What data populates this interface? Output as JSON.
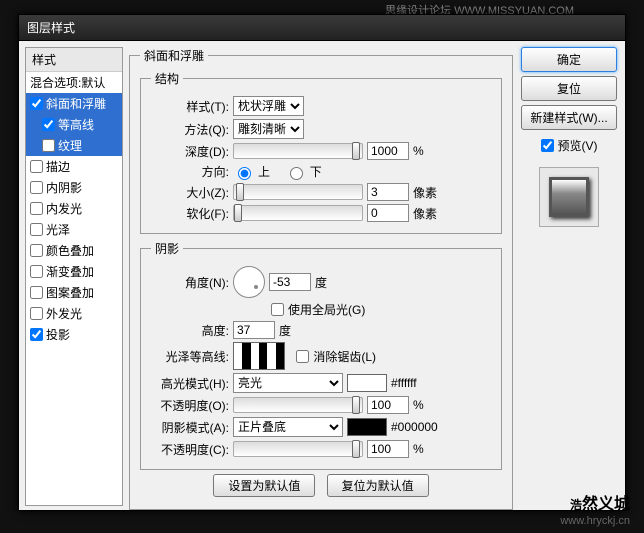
{
  "watermark_top": "思缘设计论坛 WWW.MISSYUAN.COM",
  "title": "图层样式",
  "sidebar": {
    "header": "样式",
    "blending": "混合选项:默认",
    "items": [
      {
        "label": "斜面和浮雕",
        "checked": true,
        "selected": true
      },
      {
        "label": "等高线",
        "checked": true,
        "selected": true,
        "sub": true
      },
      {
        "label": "纹理",
        "checked": false,
        "selected": true,
        "sub": true
      },
      {
        "label": "描边",
        "checked": false
      },
      {
        "label": "内阴影",
        "checked": false
      },
      {
        "label": "内发光",
        "checked": false
      },
      {
        "label": "光泽",
        "checked": false
      },
      {
        "label": "颜色叠加",
        "checked": false
      },
      {
        "label": "渐变叠加",
        "checked": false
      },
      {
        "label": "图案叠加",
        "checked": false
      },
      {
        "label": "外发光",
        "checked": false
      },
      {
        "label": "投影",
        "checked": true
      }
    ]
  },
  "main": {
    "group_title": "斜面和浮雕",
    "struct": {
      "legend": "结构",
      "style_label": "样式(T):",
      "style_value": "枕状浮雕",
      "tech_label": "方法(Q):",
      "tech_value": "雕刻清晰",
      "depth_label": "深度(D):",
      "depth_value": "1000",
      "depth_unit": "%",
      "dir_label": "方向:",
      "dir_up": "上",
      "dir_down": "下",
      "size_label": "大小(Z):",
      "size_value": "3",
      "size_unit": "像素",
      "soft_label": "软化(F):",
      "soft_value": "0",
      "soft_unit": "像素"
    },
    "shadow": {
      "legend": "阴影",
      "angle_label": "角度(N):",
      "angle_value": "-53",
      "angle_unit": "度",
      "global_label": "使用全局光(G)",
      "alt_label": "高度:",
      "alt_value": "37",
      "alt_unit": "度",
      "gloss_label": "光泽等高线:",
      "antialias_label": "消除锯齿(L)",
      "hl_mode_label": "高光模式(H):",
      "hl_mode_value": "亮光",
      "hl_hex": "#ffffff",
      "hl_op_label": "不透明度(O):",
      "hl_op_value": "100",
      "hl_op_unit": "%",
      "sh_mode_label": "阴影模式(A):",
      "sh_mode_value": "正片叠底",
      "sh_hex": "#000000",
      "sh_op_label": "不透明度(C):",
      "sh_op_value": "100",
      "sh_op_unit": "%"
    },
    "btn_default": "设置为默认值",
    "btn_reset": "复位为默认值"
  },
  "right": {
    "ok": "确定",
    "cancel": "复位",
    "new_style": "新建样式(W)...",
    "preview_label": "预览(V)"
  },
  "corner": {
    "big1": "浩",
    "big2": "然义城",
    "url": "www.hryckj.cn"
  }
}
